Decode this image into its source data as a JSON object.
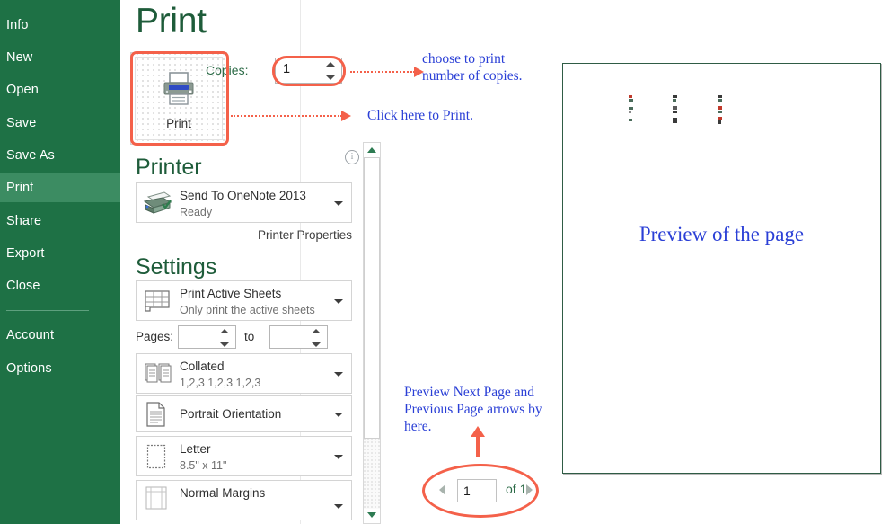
{
  "app": {
    "backstage_title": "Print",
    "accent_green": "#1e7145",
    "accent_dark_green": "#1e5c3a",
    "annotation_blue": "#2a3fd6",
    "annotation_red": "#f4614a"
  },
  "sidebar": {
    "items": [
      {
        "label": "Info",
        "selected": false
      },
      {
        "label": "New",
        "selected": false
      },
      {
        "label": "Open",
        "selected": false
      },
      {
        "label": "Save",
        "selected": false
      },
      {
        "label": "Save As",
        "selected": false
      },
      {
        "label": "Print",
        "selected": true
      },
      {
        "label": "Share",
        "selected": false
      },
      {
        "label": "Export",
        "selected": false
      },
      {
        "label": "Close",
        "selected": false
      },
      {
        "label": "Account",
        "selected": false
      },
      {
        "label": "Options",
        "selected": false
      }
    ]
  },
  "print_action": {
    "button_label": "Print",
    "icon": "printer-icon",
    "copies_label": "Copies:",
    "copies_value": "1",
    "spinner_up_icon": "spinner-up-icon",
    "spinner_down_icon": "spinner-down-icon"
  },
  "printer_section": {
    "heading": "Printer",
    "info_icon": "info-icon",
    "device_name": "Send To OneNote 2013",
    "device_status": "Ready",
    "device_icon": "printer-device-icon",
    "dropdown_icon": "chevron-down-icon",
    "properties_link": "Printer Properties"
  },
  "settings_section": {
    "heading": "Settings",
    "options": [
      {
        "icon": "sheet-grid-icon",
        "title": "Print Active Sheets",
        "subtitle": "Only print the active sheets",
        "dropdown_icon": "chevron-down-icon"
      },
      {
        "icon": "collate-icon",
        "title": "Collated",
        "subtitle": "1,2,3   1,2,3   1,2,3",
        "dropdown_icon": "chevron-down-icon"
      },
      {
        "icon": "orientation-icon",
        "title": "Portrait Orientation",
        "subtitle": "",
        "dropdown_icon": "chevron-down-icon"
      },
      {
        "icon": "paper-size-icon",
        "title": "Letter",
        "subtitle": "8.5\" x 11\"",
        "dropdown_icon": "chevron-down-icon"
      },
      {
        "icon": "margins-icon",
        "title": "Normal Margins",
        "subtitle": "",
        "dropdown_icon": "chevron-down-icon"
      }
    ],
    "pages_label": "Pages:",
    "pages_from_value": "",
    "pages_to_label": "to",
    "pages_to_value": ""
  },
  "scrollbar": {
    "up_icon": "scroll-up-icon",
    "down_icon": "scroll-down-icon",
    "name": "settings-scrollbar"
  },
  "preview": {
    "caption": "Preview of the page",
    "page_nav": {
      "prev_icon": "previous-page-arrow-icon",
      "next_icon": "next-page-arrow-icon",
      "current_page": "1",
      "of_text": "of 1"
    }
  },
  "annotations": [
    {
      "id": "copies",
      "text": "choose to print\nnumber of copies."
    },
    {
      "id": "print",
      "text": "Click here to Print."
    },
    {
      "id": "pagenav",
      "text": "Preview Next Page and\nPrevious Page arrows by\nhere."
    }
  ]
}
